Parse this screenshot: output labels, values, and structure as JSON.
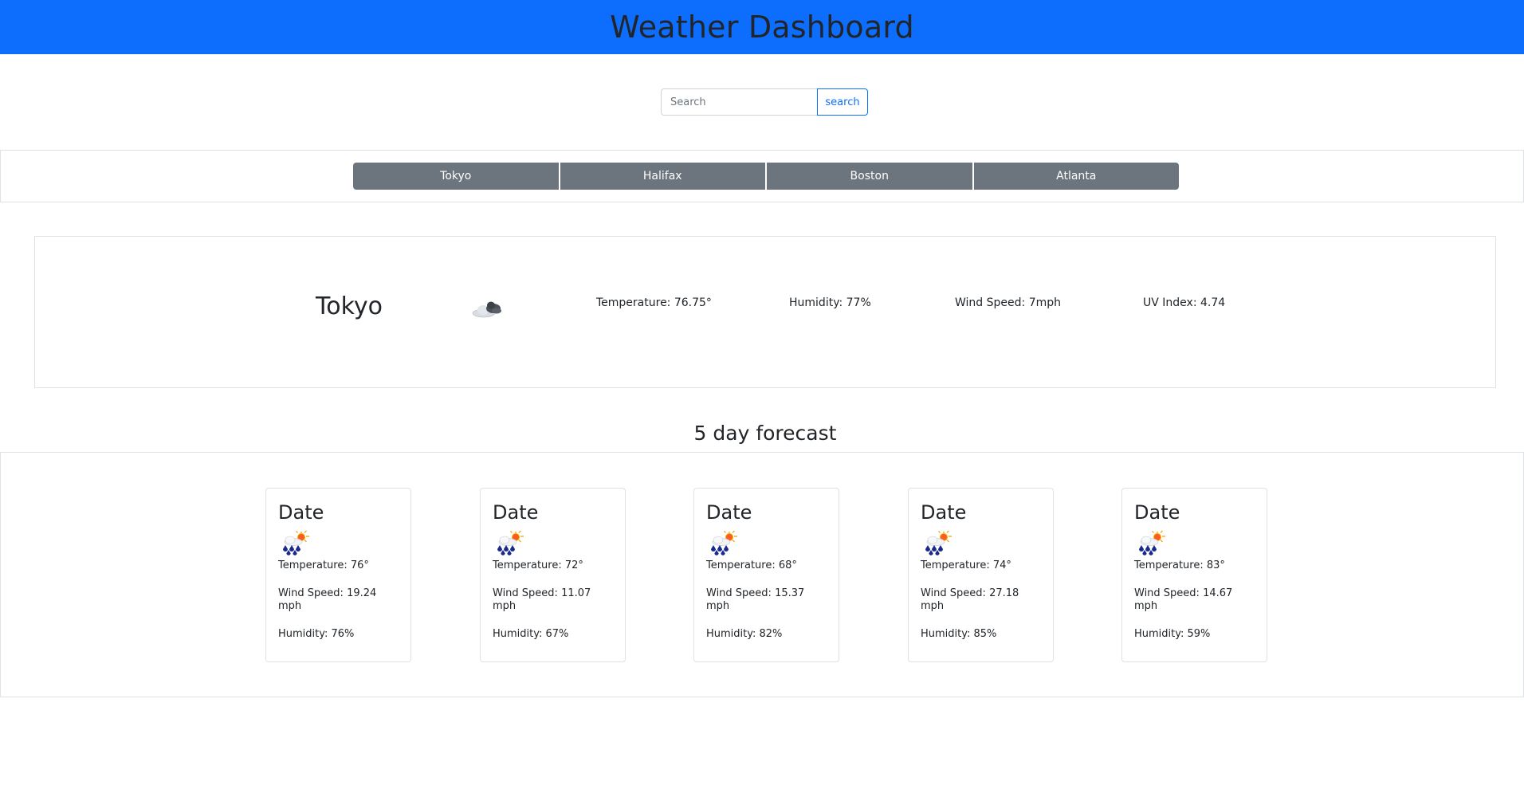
{
  "header": {
    "title": "Weather Dashboard"
  },
  "search": {
    "placeholder": "Search",
    "button_label": "search"
  },
  "history": [
    "Tokyo",
    "Halifax",
    "Boston",
    "Atlanta"
  ],
  "current": {
    "city": "Tokyo",
    "icon": "cloudy-icon",
    "temperature": "Temperature: 76.75°",
    "humidity": "Humidity: 77%",
    "wind_speed": "Wind Speed: 7mph",
    "uv_index": "UV Index: 4.74"
  },
  "forecast": {
    "title": "5 day forecast",
    "days": [
      {
        "date": "Date",
        "icon": "rain-sun-icon",
        "temperature": "Temperature: 76°",
        "wind": "Wind Speed: 19.24 mph",
        "humidity": "Humidity: 76%"
      },
      {
        "date": "Date",
        "icon": "rain-sun-icon",
        "temperature": "Temperature: 72°",
        "wind": "Wind Speed: 11.07 mph",
        "humidity": "Humidity: 67%"
      },
      {
        "date": "Date",
        "icon": "rain-sun-icon",
        "temperature": "Temperature: 68°",
        "wind": "Wind Speed: 15.37 mph",
        "humidity": "Humidity: 82%"
      },
      {
        "date": "Date",
        "icon": "rain-sun-icon",
        "temperature": "Temperature: 74°",
        "wind": "Wind Speed: 27.18 mph",
        "humidity": "Humidity: 85%"
      },
      {
        "date": "Date",
        "icon": "rain-sun-icon",
        "temperature": "Temperature: 83°",
        "wind": "Wind Speed: 14.67 mph",
        "humidity": "Humidity: 59%"
      }
    ]
  },
  "colors": {
    "accent": "#0d6efd",
    "history_button": "#6c757d",
    "border": "#dee2e6"
  }
}
